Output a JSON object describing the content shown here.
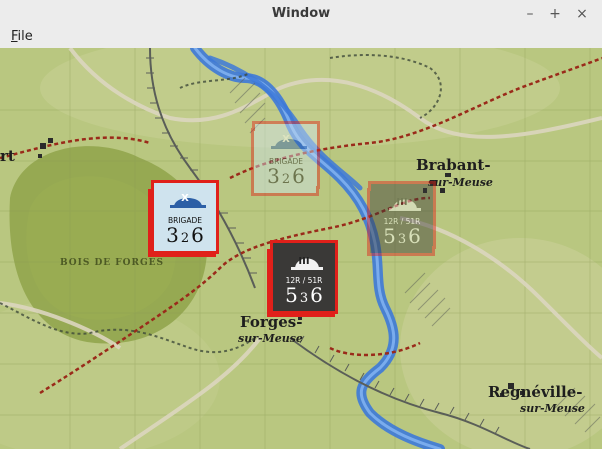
{
  "window": {
    "title": "Window",
    "minimize": "–",
    "maximize": "+",
    "close": "×"
  },
  "menu": {
    "file": "File"
  },
  "map": {
    "places": {
      "rt": "rt",
      "brabant": "Brabant-",
      "brabant_sub": "sur-Meuse",
      "forges": "Forges-",
      "forges_sub": "sur-Meuse",
      "regneville": "Regnéville-",
      "regneville_sub": "sur-Meuse",
      "bois": "BOIS DE FORGES"
    },
    "colors": {
      "river": "#3d79d8",
      "road": "#d9d2b8",
      "rail": "#5a5e58",
      "border": "#9a2a1a",
      "counter_border": "#e0201a"
    }
  },
  "counters": [
    {
      "id": "french-brigade-selected",
      "symbol": "X",
      "unit": "BRIGADE",
      "attack": "3",
      "range": "2",
      "defense": "6",
      "face": "#cfe3ee",
      "helmet": "#2c5fa6",
      "text": "#111111",
      "opacity": 1
    },
    {
      "id": "french-brigade-ghost",
      "symbol": "X",
      "unit": "BRIGADE",
      "attack": "3",
      "range": "2",
      "defense": "6",
      "face": "#cfe3ee",
      "helmet": "#2c5fa6",
      "text": "#111111",
      "opacity": 0.45
    },
    {
      "id": "german-regiment-selected",
      "symbol": "III",
      "unit": "12R / 51R",
      "attack": "5",
      "range": "3",
      "defense": "6",
      "face": "#3a3937",
      "helmet": "#f2f2f2",
      "text": "#ffffff",
      "opacity": 1
    },
    {
      "id": "german-regiment-ghost",
      "symbol": "III",
      "unit": "12R / 51R",
      "attack": "5",
      "range": "3",
      "defense": "6",
      "face": "#3a3937",
      "helmet": "#f2f2f2",
      "text": "#ffffff",
      "opacity": 0.45
    }
  ]
}
